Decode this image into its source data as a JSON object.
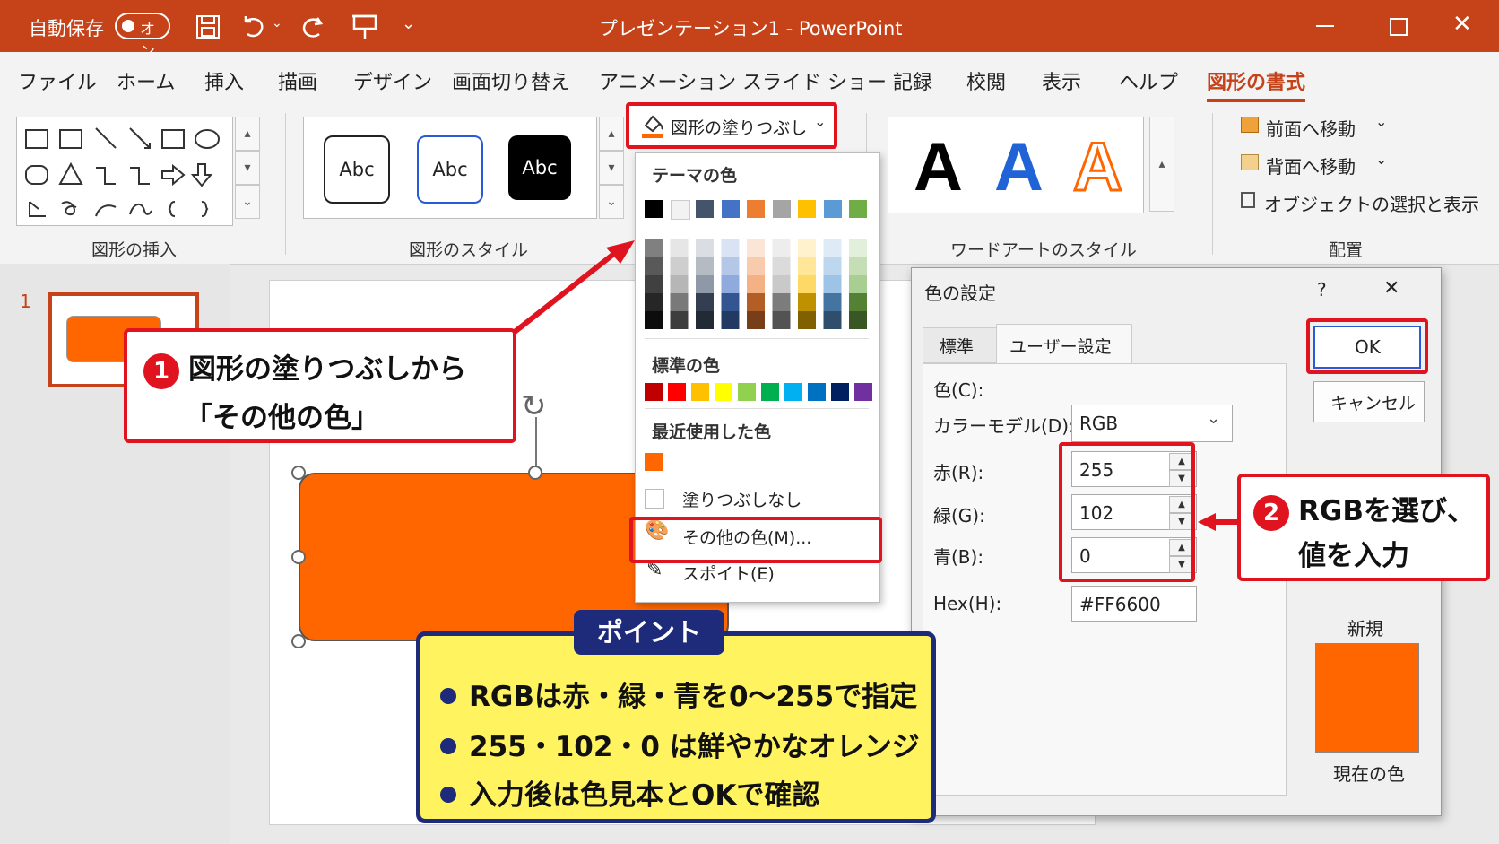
{
  "titlebar": {
    "autosave_label": "自動保存",
    "autosave_toggle": "オン",
    "title": "プレゼンテーション1 - PowerPoint",
    "icons": [
      "save-icon",
      "undo-icon",
      "redo-icon",
      "present-icon",
      "customize-icon",
      "minimize-icon",
      "maximize-icon",
      "close-icon"
    ]
  },
  "tabs": [
    "ファイル",
    "ホーム",
    "挿入",
    "描画",
    "デザイン",
    "画面切り替え",
    "アニメーション",
    "スライド ショー",
    "記録",
    "校閲",
    "表示",
    "ヘルプ",
    "図形の書式"
  ],
  "ribbon": {
    "insert_shapes_label": "図形の挿入",
    "shape_styles_label": "図形のスタイル",
    "style_samples": [
      "Abc",
      "Abc",
      "Abc"
    ],
    "fill_button": "図形の塗りつぶし",
    "wordart_samples": [
      "A",
      "A",
      "A"
    ],
    "wordart_label": "ワードアートのスタイル",
    "arrange": {
      "bring_forward": "前面へ移動",
      "send_backward": "背面へ移動",
      "selection_pane": "オブジェクトの選択と表示",
      "label": "配置"
    }
  },
  "slides": {
    "thumb_number": "1"
  },
  "fill_menu": {
    "theme_colors_head": "テーマの色",
    "theme_top": [
      "#000000",
      "#f2f2f2",
      "#44546a",
      "#4472c4",
      "#ed7d31",
      "#a5a5a5",
      "#ffc000",
      "#5b9bd5",
      "#70ad47"
    ],
    "standard_head": "標準の色",
    "standard_colors": [
      "#c00000",
      "#ff0000",
      "#ffc000",
      "#ffff00",
      "#92d050",
      "#00b050",
      "#00b0f0",
      "#0070c0",
      "#002060",
      "#7030a0"
    ],
    "recent_head": "最近使用した色",
    "recent_colors": [
      "#ff6600"
    ],
    "no_fill": "塗りつぶしなし",
    "more_colors": "その他の色(M)...",
    "eyedropper": "スポイト(E)"
  },
  "dialog": {
    "title": "色の設定",
    "help": "?",
    "close": "✕",
    "tab_standard": "標準",
    "tab_custom": "ユーザー設定",
    "color_label": "色(C):",
    "model_label": "カラーモデル(D):",
    "model_value": "RGB",
    "red_label": "赤(R):",
    "red_value": "255",
    "green_label": "緑(G):",
    "green_value": "102",
    "blue_label": "青(B):",
    "blue_value": "0",
    "hex_label": "Hex(H):",
    "hex_value": "#FF6600",
    "ok": "OK",
    "cancel": "キャンセル",
    "new_label": "新規",
    "current_label": "現在の色",
    "new_color": "#ff6600",
    "current_color": "#ff6600"
  },
  "callouts": {
    "step1_num": "1",
    "step1_line1": "図形の塗りつぶしから",
    "step1_line2": "「その他の色」",
    "step2_num": "2",
    "step2_line1": "RGBを選び、",
    "step2_line2": "値を入力"
  },
  "point": {
    "title": "ポイント",
    "lines": [
      "RGBは赤・緑・青を0〜255で指定",
      "255・102・0 は鮮やかなオレンジ",
      "入力後は色見本とOKで確認"
    ]
  },
  "colors": {
    "accent": "#c6431a",
    "shape": "#ff6600",
    "callout_red": "#e0141e",
    "point_bg": "#fff45f",
    "point_border": "#1e2a7a"
  }
}
